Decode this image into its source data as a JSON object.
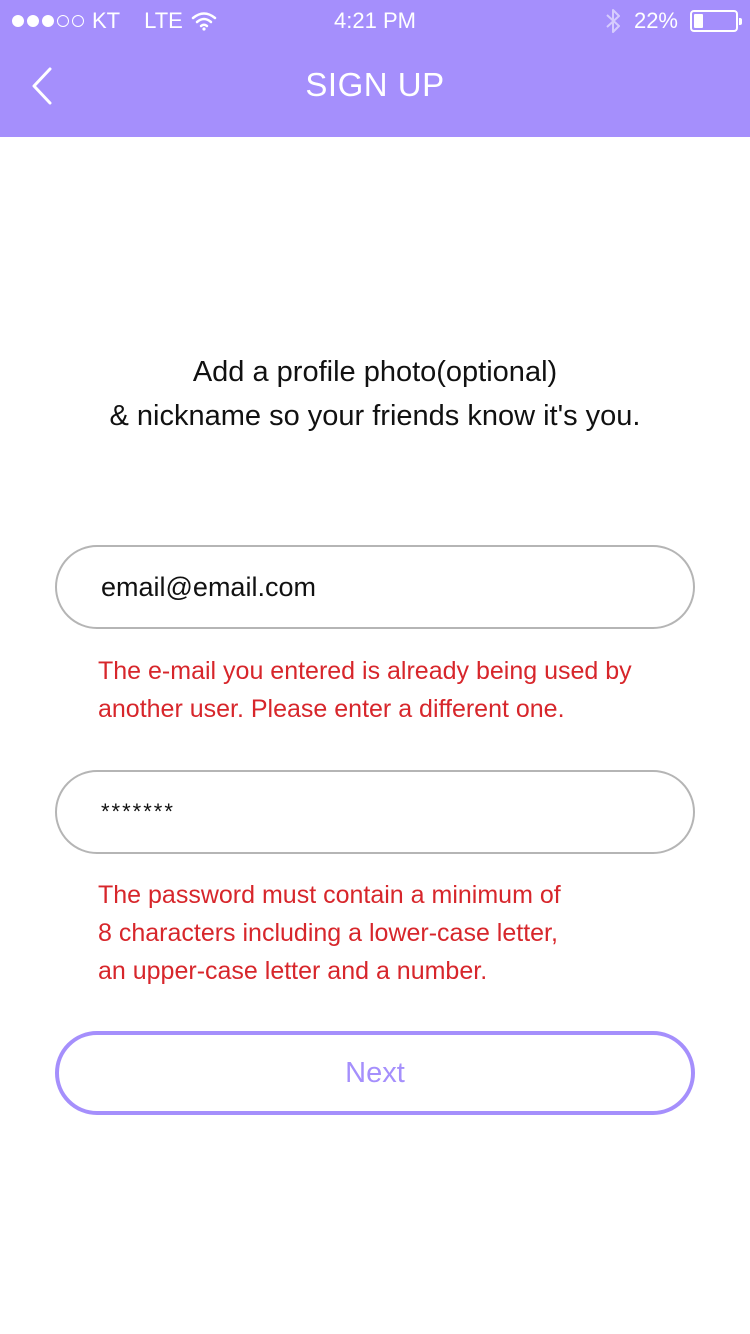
{
  "status_bar": {
    "carrier": "KT",
    "network": "LTE",
    "time": "4:21 PM",
    "battery": "22%",
    "battery_level": 0.22,
    "icons": [
      "signal-dots-icon",
      "wifi-icon",
      "bluetooth-icon",
      "battery-icon"
    ]
  },
  "header": {
    "title": "SIGN UP",
    "back_icon": "chevron-left-icon",
    "background_color": "#a58ffc"
  },
  "intro": {
    "line1": "Add a profile photo(optional)",
    "line2": "& nickname so your friends know it's you."
  },
  "email": {
    "value": "email@email.com",
    "error": "The e-mail you entered is already being used by\nanother user. Please enter a different one."
  },
  "password": {
    "value": "*******",
    "error": "The password must contain a minimum of\n8 characters including a lower-case letter,\nan upper-case letter and a number."
  },
  "next_button": {
    "label": "Next",
    "color": "#a58ffc"
  },
  "colors": {
    "accent": "#a58ffc",
    "error": "#d7262b",
    "border": "#b5b5b5"
  }
}
